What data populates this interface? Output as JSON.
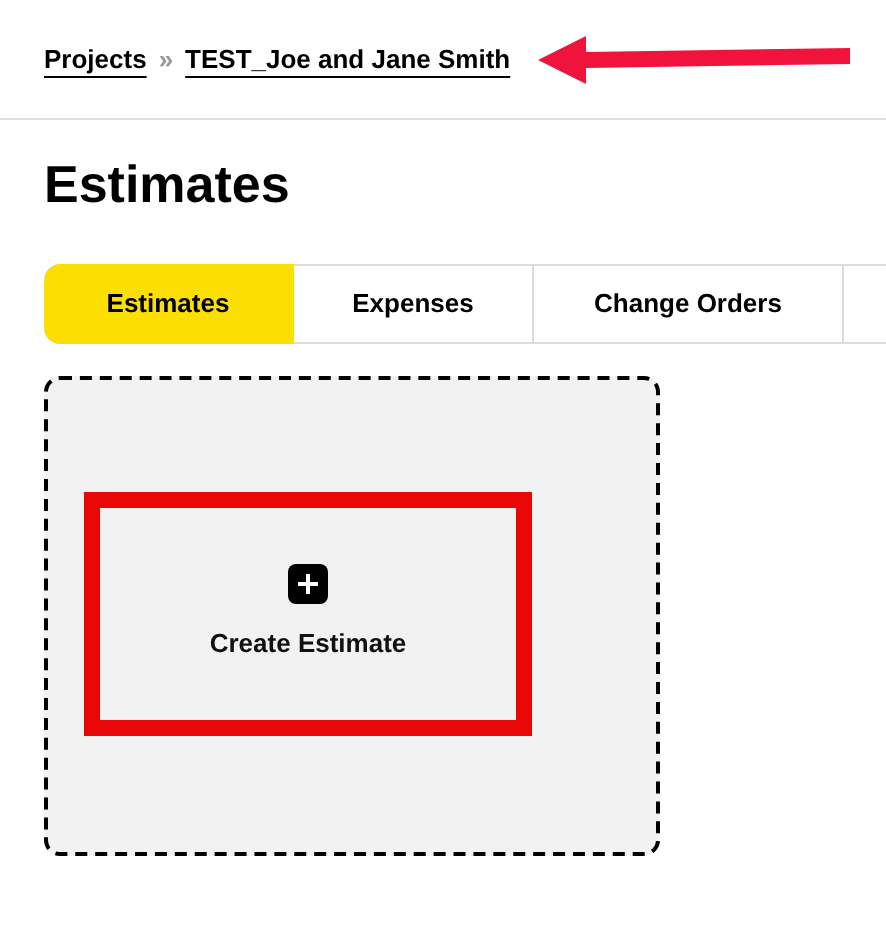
{
  "breadcrumb": [
    {
      "label": "Projects"
    },
    {
      "label": "TEST_Joe and Jane Smith"
    }
  ],
  "breadcrumb_separator": "»",
  "title": "Estimates",
  "tabs": [
    {
      "label": "Estimates",
      "selected": true
    },
    {
      "label": "Expenses",
      "selected": false
    },
    {
      "label": "Change Orders",
      "selected": false
    }
  ],
  "create_card": {
    "label": "Create Estimate"
  }
}
